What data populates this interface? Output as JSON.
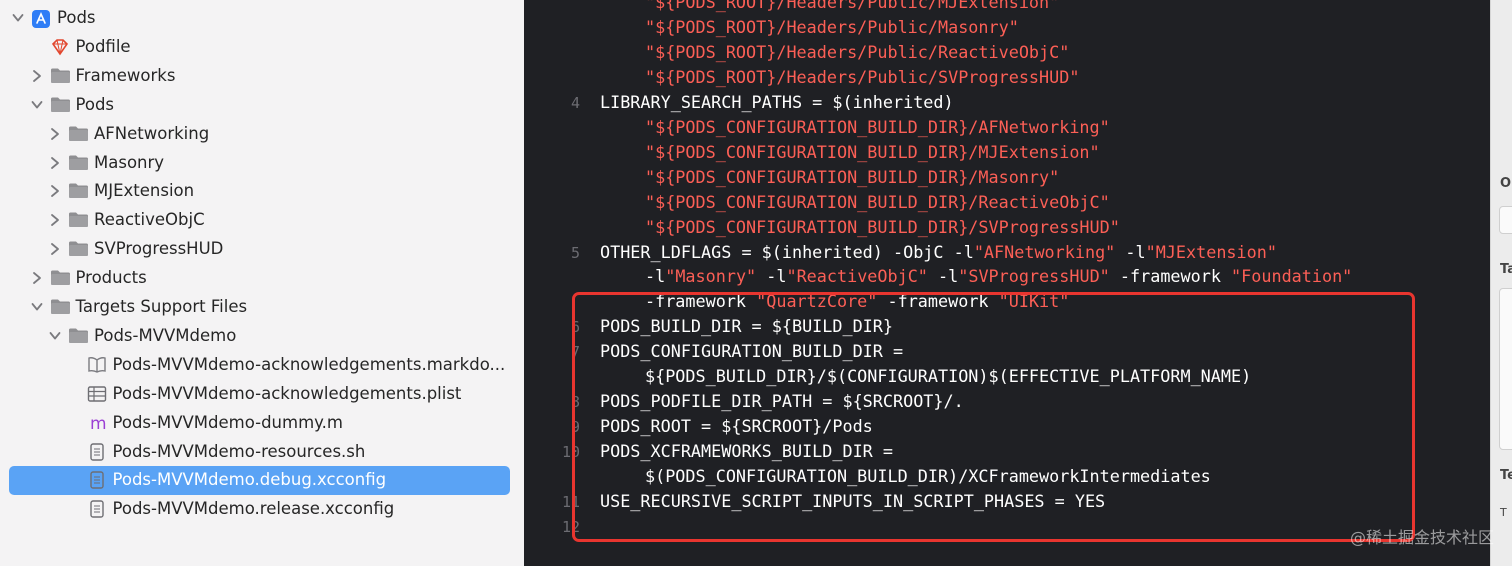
{
  "navigator": {
    "items": [
      {
        "label": "Pods",
        "icon": "app-project-icon",
        "expanded": true,
        "kind": "project"
      },
      {
        "label": "Podfile",
        "icon": "ruby-gem-icon",
        "kind": "file"
      },
      {
        "label": "Frameworks",
        "icon": "folder-icon",
        "expanded": false,
        "kind": "group"
      },
      {
        "label": "Pods",
        "icon": "folder-icon",
        "expanded": true,
        "kind": "group"
      },
      {
        "label": "AFNetworking",
        "icon": "folder-icon",
        "expanded": false,
        "kind": "group"
      },
      {
        "label": "Masonry",
        "icon": "folder-icon",
        "expanded": false,
        "kind": "group"
      },
      {
        "label": "MJExtension",
        "icon": "folder-icon",
        "expanded": false,
        "kind": "group"
      },
      {
        "label": "ReactiveObjC",
        "icon": "folder-icon",
        "expanded": false,
        "kind": "group"
      },
      {
        "label": "SVProgressHUD",
        "icon": "folder-icon",
        "expanded": false,
        "kind": "group"
      },
      {
        "label": "Products",
        "icon": "folder-icon",
        "expanded": false,
        "kind": "group"
      },
      {
        "label": "Targets Support Files",
        "icon": "folder-icon",
        "expanded": true,
        "kind": "group"
      },
      {
        "label": "Pods-MVVMdemo",
        "icon": "folder-icon",
        "expanded": true,
        "kind": "group"
      },
      {
        "label": "Pods-MVVMdemo-acknowledgements.markdo...",
        "icon": "book-icon",
        "kind": "file"
      },
      {
        "label": "Pods-MVVMdemo-acknowledgements.plist",
        "icon": "plist-table-icon",
        "kind": "file"
      },
      {
        "label": "Pods-MVVMdemo-dummy.m",
        "icon": "objc-m-icon",
        "kind": "file"
      },
      {
        "label": "Pods-MVVMdemo-resources.sh",
        "icon": "document-icon",
        "kind": "file"
      },
      {
        "label": "Pods-MVVMdemo.debug.xcconfig",
        "icon": "document-icon",
        "kind": "file",
        "selected": true
      },
      {
        "label": "Pods-MVVMdemo.release.xcconfig",
        "icon": "document-icon",
        "kind": "file"
      }
    ]
  },
  "editor": {
    "line_numbers": [
      "4",
      "5",
      "6",
      "7",
      "8",
      "9",
      "10",
      "11",
      "12"
    ],
    "lines": [
      {
        "plain": "",
        "str": "\"${PODS_ROOT}/Headers/Public/MJExtension\""
      },
      {
        "plain": "",
        "str": "\"${PODS_ROOT}/Headers/Public/Masonry\""
      },
      {
        "plain": "",
        "str": "\"${PODS_ROOT}/Headers/Public/ReactiveObjC\""
      },
      {
        "plain": "",
        "str": "\"${PODS_ROOT}/Headers/Public/SVProgressHUD\""
      },
      {
        "plain": "LIBRARY_SEARCH_PATHS = $(inherited)",
        "str": ""
      },
      {
        "plain": "",
        "str": "\"${PODS_CONFIGURATION_BUILD_DIR}/AFNetworking\""
      },
      {
        "plain": "",
        "str": "\"${PODS_CONFIGURATION_BUILD_DIR}/MJExtension\""
      },
      {
        "plain": "",
        "str": "\"${PODS_CONFIGURATION_BUILD_DIR}/Masonry\""
      },
      {
        "plain": "",
        "str": "\"${PODS_CONFIGURATION_BUILD_DIR}/ReactiveObjC\""
      },
      {
        "plain": "",
        "str": "\"${PODS_CONFIGURATION_BUILD_DIR}/SVProgressHUD\""
      },
      {
        "parts": [
          "OTHER_LDFLAGS = $(inherited) -ObjC -l",
          "\"AFNetworking\"",
          " -l",
          "\"MJExtension\""
        ]
      },
      {
        "parts": [
          "-l",
          "\"Masonry\"",
          " -l",
          "\"ReactiveObjC\"",
          " -l",
          "\"SVProgressHUD\"",
          " -framework ",
          "\"Foundation\""
        ]
      },
      {
        "parts": [
          "-framework ",
          "\"QuartzCore\"",
          " -framework ",
          "\"UIKit\""
        ]
      },
      {
        "plain": "PODS_BUILD_DIR = ${BUILD_DIR}",
        "str": ""
      },
      {
        "plain": "PODS_CONFIGURATION_BUILD_DIR =",
        "str": ""
      },
      {
        "plain": "${PODS_BUILD_DIR}/$(CONFIGURATION)$(EFFECTIVE_PLATFORM_NAME)",
        "str": ""
      },
      {
        "plain": "PODS_PODFILE_DIR_PATH = ${SRCROOT}/.",
        "str": ""
      },
      {
        "plain": "PODS_ROOT = ${SRCROOT}/Pods",
        "str": ""
      },
      {
        "plain": "PODS_XCFRAMEWORKS_BUILD_DIR =",
        "str": ""
      },
      {
        "plain": "$(PODS_CONFIGURATION_BUILD_DIR)/XCFrameworkIntermediates",
        "str": ""
      },
      {
        "plain": "USE_RECURSIVE_SCRIPT_INPUTS_IN_SCRIPT_PHASES = YES",
        "str": ""
      }
    ]
  },
  "inspector": {
    "labels": [
      "O",
      "Ta",
      "Te",
      "T"
    ]
  },
  "watermark": "@稀土掘金技术社区",
  "colors": {
    "navigator_bg": "#f4f3f4",
    "selection": "#5aa3f5",
    "editor_bg": "#1f2024",
    "string": "#fc5f56",
    "highlight_box": "#e8352f"
  }
}
